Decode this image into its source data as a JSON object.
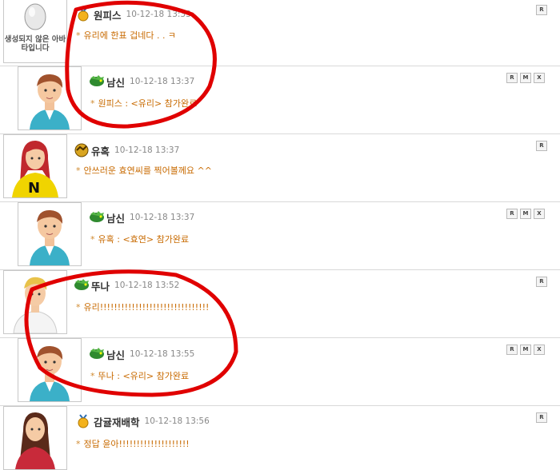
{
  "comments": [
    {
      "avatar": "egg-placeholder-avatar",
      "avatar_text": "생성되지 않은 아바타입니다",
      "badge": "gold-medal-icon",
      "nick": "원피스",
      "time": "10-12-18 13:33",
      "message": "유리에  한표  겁네다 . . ㅋ",
      "buttons": [
        "R"
      ]
    },
    {
      "avatar": "boy-avatar",
      "badge": "green-dragon-icon",
      "nick": "남신",
      "time": "10-12-18 13:37",
      "message": "원피스 : <유리> 참가완료",
      "buttons": [
        "R",
        "M",
        "X"
      ]
    },
    {
      "avatar": "redhair-n-shirt-avatar",
      "badge": "gold-dragon-icon",
      "nick": "유혹",
      "time": "10-12-18 13:37",
      "message": "안쓰러운 효연씨를 찍어볼께요 ^^",
      "buttons": [
        "R"
      ]
    },
    {
      "avatar": "boy-avatar",
      "badge": "green-dragon-icon",
      "nick": "남신",
      "time": "10-12-18 13:37",
      "message": "유혹 : <효연> 참가완료",
      "buttons": [
        "R",
        "M",
        "X"
      ]
    },
    {
      "avatar": "blonde-avatar",
      "badge": "green-dragon-icon",
      "nick": "뚜나",
      "time": "10-12-18 13:52",
      "message": "유리!!!!!!!!!!!!!!!!!!!!!!!!!!!!!!!",
      "buttons": [
        "R"
      ]
    },
    {
      "avatar": "boy-avatar",
      "badge": "green-dragon-icon",
      "nick": "남신",
      "time": "10-12-18 13:55",
      "message": "뚜나 : <유리> 참가완료",
      "buttons": [
        "R",
        "M",
        "X"
      ]
    },
    {
      "avatar": "girl-avatar",
      "badge": "gold-medal-icon",
      "nick": "감귤재배학",
      "time": "10-12-18 13:56",
      "message": "정답 윤아!!!!!!!!!!!!!!!!!!!!",
      "buttons": [
        "R"
      ]
    }
  ],
  "colors": {
    "message": "#c86a00",
    "annotation": "#e00000",
    "nick": "#333333",
    "time": "#888888"
  }
}
